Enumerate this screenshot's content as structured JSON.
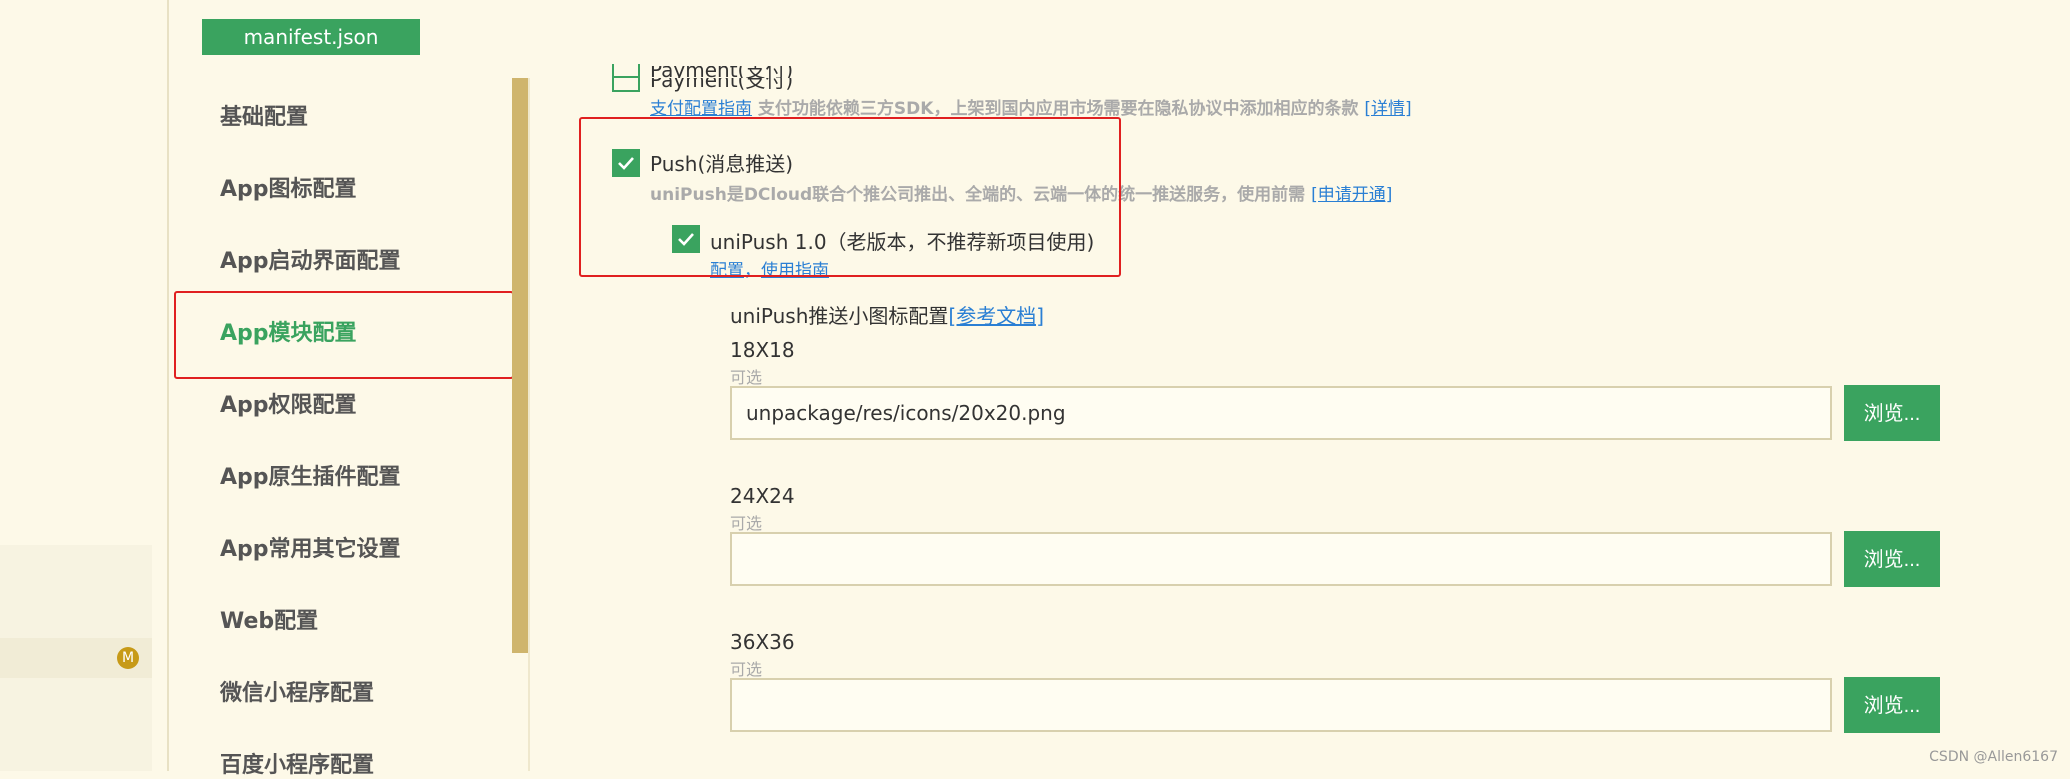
{
  "tab": {
    "label": "manifest.json"
  },
  "explorer": {
    "badge": "M"
  },
  "nav": {
    "items": [
      "基础配置",
      "App图标配置",
      "App启动界面配置",
      "App模块配置",
      "App权限配置",
      "App原生插件配置",
      "App常用其它设置",
      "Web配置",
      "微信小程序配置",
      "百度小程序配置"
    ],
    "active_index": 3
  },
  "payment": {
    "label": "Payment(支付)",
    "link": "支付配置指南",
    "desc": "支付功能依赖三方SDK，上架到国内应用市场需要在隐私协议中添加相应的条款",
    "detail_link": "[详情]",
    "checked": false
  },
  "push": {
    "label": "Push(消息推送)",
    "desc": "uniPush是DCloud联合个推公司推出、全端的、云端一体的统一推送服务，使用前需",
    "apply_link": "[申请开通]",
    "checked": true,
    "unipush1": {
      "label": "uniPush 1.0（老版本，不推荐新项目使用)",
      "config_link": "配置",
      "separator": "，",
      "guide_link": "使用指南",
      "checked": true
    }
  },
  "icon_config": {
    "title": "uniPush推送小图标配置",
    "doc_link": "[参考文档]",
    "optional": "可选",
    "browse": "浏览...",
    "sizes": [
      {
        "label": "18X18",
        "value": "unpackage/res/icons/20x20.png"
      },
      {
        "label": "24X24",
        "value": ""
      },
      {
        "label": "36X36",
        "value": ""
      }
    ]
  },
  "watermark": "CSDN @Allen6167",
  "colors": {
    "accent": "#3aa35f",
    "highlight": "#e02020",
    "link": "#2a7fd4",
    "background": "#fdf9e8"
  }
}
